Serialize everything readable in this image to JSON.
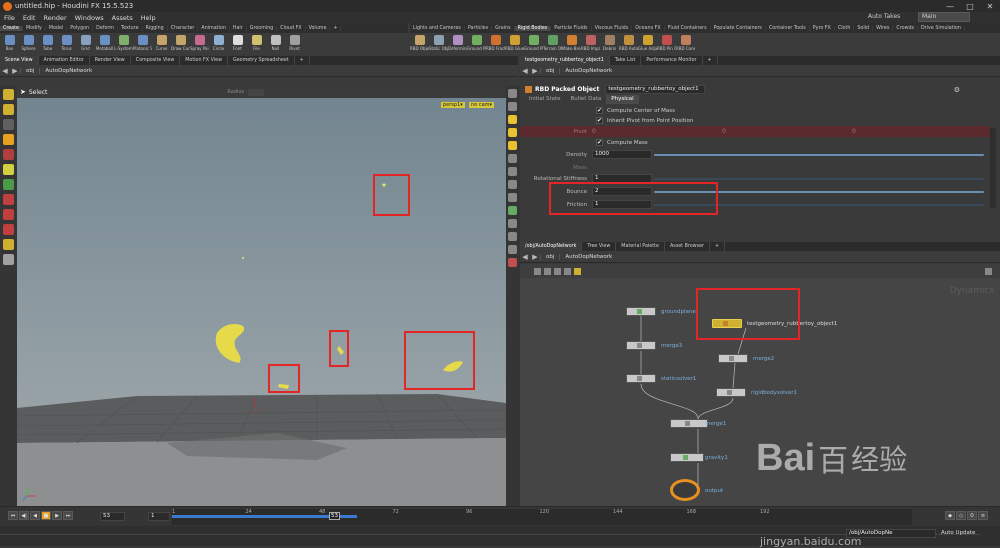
{
  "window": {
    "title": "untitled.hip - Houdini FX 15.5.523",
    "minimize": "—",
    "maximize": "□",
    "close": "✕"
  },
  "menu": [
    "File",
    "Edit",
    "Render",
    "Windows",
    "Assets",
    "Help"
  ],
  "top_right": {
    "auto_takes": "Auto Takes",
    "desktop": "Main"
  },
  "shelf_tabs_left": [
    "Create",
    "Modify",
    "Model",
    "Polygon",
    "Deform",
    "Texture",
    "Rigging",
    "Character",
    "Animation",
    "Hair",
    "Grooming",
    "Cloud FX",
    "Volume",
    "+"
  ],
  "shelf_tabs_right": [
    "Lights and Cameras",
    "Particles",
    "Grains",
    "Rigid Bodies",
    "Particle Fluids",
    "Viscous Fluids",
    "Oceans FX",
    "Fluid Containers",
    "Populate Containers",
    "Container Tools",
    "Pyro FX",
    "Cloth",
    "Solid",
    "Wires",
    "Crowds",
    "Drive Simulation"
  ],
  "tools_left": [
    {
      "label": "Box",
      "icon": "box-icon",
      "color": "#6b8fc4"
    },
    {
      "label": "Sphere",
      "icon": "sphere-icon",
      "color": "#6b8fc4"
    },
    {
      "label": "Tube",
      "icon": "tube-icon",
      "color": "#6b8fc4"
    },
    {
      "label": "Torus",
      "icon": "torus-icon",
      "color": "#6b8fc4"
    },
    {
      "label": "Grid",
      "icon": "grid-icon",
      "color": "#8aa0c0"
    },
    {
      "label": "Metaball",
      "icon": "metaball-icon",
      "color": "#6b8fc4"
    },
    {
      "label": "L-System",
      "icon": "lsystem-icon",
      "color": "#7fb06b"
    },
    {
      "label": "Platonic Sol...",
      "icon": "platonic-icon",
      "color": "#6b8fc4"
    },
    {
      "label": "Curve",
      "icon": "curve-icon",
      "color": "#c4a46b"
    },
    {
      "label": "Draw Curve",
      "icon": "draw-curve-icon",
      "color": "#c4a46b"
    },
    {
      "label": "Spray Paint",
      "icon": "spray-paint-icon",
      "color": "#c46b8f"
    },
    {
      "label": "Circle",
      "icon": "circle-icon",
      "color": "#8fb0d0"
    },
    {
      "label": "Font",
      "icon": "font-icon",
      "color": "#dddddd"
    },
    {
      "label": "File",
      "icon": "file-icon",
      "color": "#d0c070"
    },
    {
      "label": "Null",
      "icon": "null-icon",
      "color": "#c0c0c0"
    },
    {
      "label": "Rivet",
      "icon": "rivet-icon",
      "color": "#a0a0a0"
    }
  ],
  "tools_right": [
    {
      "label": "RBD Object",
      "icon": "rbd-object-icon",
      "color": "#c4a46b"
    },
    {
      "label": "Static Object",
      "icon": "static-object-icon",
      "color": "#8fa0b0"
    },
    {
      "label": "Deforming",
      "icon": "deforming-icon",
      "color": "#b08fc4"
    },
    {
      "label": "Ground Plane",
      "icon": "ground-plane-icon",
      "color": "#70b060"
    },
    {
      "label": "RBD Fractur...",
      "icon": "rbd-fracture-icon",
      "color": "#d07030"
    },
    {
      "label": "RBD Glue O...",
      "icon": "rbd-glue-icon",
      "color": "#d0a030"
    },
    {
      "label": "Ground Plane",
      "icon": "ground-plane-icon",
      "color": "#70b060"
    },
    {
      "label": "Terrain Object",
      "icon": "terrain-icon",
      "color": "#60a060"
    },
    {
      "label": "Make Break...",
      "icon": "make-breakable-icon",
      "color": "#d08030"
    },
    {
      "label": "RBD Impacts",
      "icon": "rbd-impacts-icon",
      "color": "#c06060"
    },
    {
      "label": "Debris",
      "icon": "debris-icon",
      "color": "#a08060"
    },
    {
      "label": "RBD Auto F...",
      "icon": "rbd-auto-icon",
      "color": "#c09040"
    },
    {
      "label": "Glue Adjacent",
      "icon": "glue-adjacent-icon",
      "color": "#d0a030"
    },
    {
      "label": "RBD Pin Co...",
      "icon": "rbd-pin-icon",
      "color": "#c05050"
    },
    {
      "label": "RBD Cone T...",
      "icon": "rbd-cone-icon",
      "color": "#c08060"
    }
  ],
  "left_tabs": [
    "Scene View",
    "Animation Editor",
    "Render View",
    "Composite View",
    "Motion FX View",
    "Geometry Spreadsheet",
    "+"
  ],
  "param_tabs": [
    "testgeometry_rubbertoy_object1",
    "Take List",
    "Performance Monitor",
    "+"
  ],
  "net_tabs": [
    "/obj/AutoDopNetwork",
    "Tree View",
    "Material Palette",
    "Asset Browser",
    "+"
  ],
  "path": {
    "root": "obj",
    "net": "AutoDopNetwork"
  },
  "viewport": {
    "tool": "Select",
    "radius_label": "Radius",
    "persp": "persp1▾",
    "cam": "no cam▾"
  },
  "params": {
    "node_type": "RBD Packed Object",
    "node_name": "testgeometry_rubbertoy_object1",
    "tabs": [
      "Initial State",
      "Bullet Data",
      "Physical"
    ],
    "compute_com": "Compute Center of Mass",
    "inherit_pivot": "Inherit Pivot from Point Position",
    "pivot_label": "Pivot",
    "pivot_values": [
      "0",
      "0",
      "0"
    ],
    "compute_mass": "Compute Mass",
    "density_label": "Density",
    "density": "1000",
    "mass_label": "Mass",
    "rot_stiff_label": "Rotational Stiffness",
    "rot_stiff": "1",
    "bounce_label": "Bounce",
    "bounce": "2",
    "friction_label": "Friction",
    "friction": "1"
  },
  "network": {
    "watermark": "Dynamics",
    "nodes": {
      "groundplane": "groundplane",
      "rubbertoy": "testgeometry_rubbertoy_object1",
      "merge3": "merge3",
      "merge2": "merge2",
      "staticsolver1": "staticsolver1",
      "rigidbodysolver1": "rigidbodysolver1",
      "merge1": "merge1",
      "gravity1": "gravity1",
      "output": "output"
    }
  },
  "timeline": {
    "current_frame": "53",
    "start": "1",
    "ticks": [
      "1",
      "24",
      "48",
      "72",
      "96",
      "120",
      "144",
      "168",
      "192"
    ],
    "marker": "53",
    "progress": 0.25
  },
  "status": {
    "path": "/obj/AutoDopNe",
    "auto_update": "Auto Update"
  },
  "watermark": {
    "brand": "Bai",
    "brand2": "百",
    "brand3": "经验",
    "url": "jingyan.baidu.com"
  }
}
